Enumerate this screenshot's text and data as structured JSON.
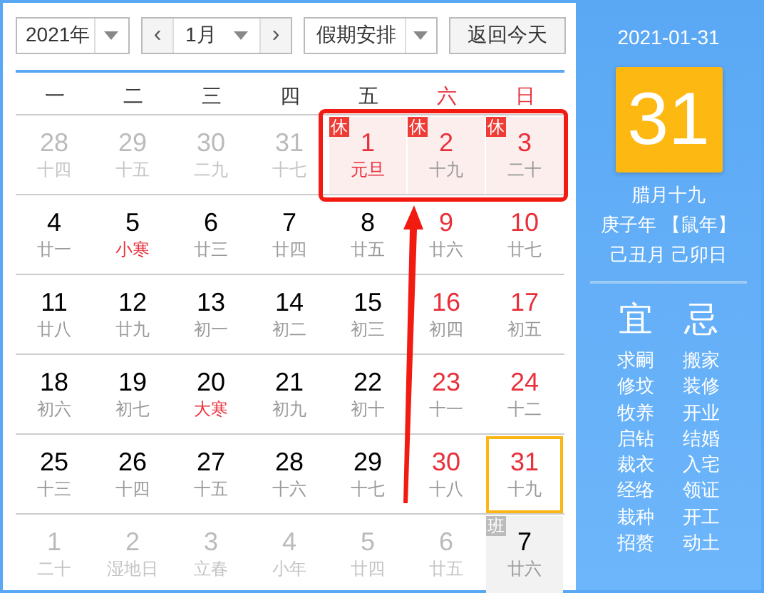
{
  "toolbar": {
    "year": "2021年",
    "prev": "‹",
    "month": "1月",
    "next": "›",
    "holiday_select": "假期安排",
    "today_button": "返回今天"
  },
  "weekdays": [
    {
      "label": "一",
      "weekend": false
    },
    {
      "label": "二",
      "weekend": false
    },
    {
      "label": "三",
      "weekend": false
    },
    {
      "label": "四",
      "weekend": false
    },
    {
      "label": "五",
      "weekend": false
    },
    {
      "label": "六",
      "weekend": true
    },
    {
      "label": "日",
      "weekend": true
    }
  ],
  "rows": [
    {
      "days": [
        {
          "day": "28",
          "lunar": "十四",
          "faded": true,
          "selected": false
        },
        {
          "day": "29",
          "lunar": "十五",
          "faded": true,
          "selected": false
        },
        {
          "day": "30",
          "lunar": "二九",
          "faded": true,
          "selected": false
        },
        {
          "day": "31",
          "lunar": "十七",
          "faded": true,
          "selected": false
        },
        {
          "day": "1",
          "lunar": "元旦",
          "faded": false,
          "festival": true,
          "selected": false,
          "tag": "休",
          "kind": "rest"
        },
        {
          "day": "2",
          "lunar": "十九",
          "faded": false,
          "festival": false,
          "selected": false,
          "tag": "休",
          "kind": "rest"
        },
        {
          "day": "3",
          "lunar": "二十",
          "faded": false,
          "festival": false,
          "selected": false,
          "tag": "休",
          "kind": "rest"
        }
      ]
    },
    {
      "days": [
        {
          "day": "4",
          "lunar": "廿一",
          "faded": false,
          "weekend": false,
          "festival": false,
          "selected": false
        },
        {
          "day": "5",
          "lunar": "小寒",
          "faded": false,
          "weekend": false,
          "festival": true,
          "selected": false
        },
        {
          "day": "6",
          "lunar": "廿三",
          "faded": false,
          "weekend": false,
          "festival": false,
          "selected": false
        },
        {
          "day": "7",
          "lunar": "廿四",
          "faded": false,
          "weekend": false,
          "festival": false,
          "selected": false
        },
        {
          "day": "8",
          "lunar": "廿五",
          "faded": false,
          "weekend": false,
          "festival": false,
          "selected": false
        },
        {
          "day": "9",
          "lunar": "廿六",
          "faded": false,
          "weekend": true,
          "festival": false,
          "selected": false
        },
        {
          "day": "10",
          "lunar": "廿七",
          "faded": false,
          "weekend": true,
          "festival": false,
          "selected": false
        }
      ]
    },
    {
      "days": [
        {
          "day": "11",
          "lunar": "廿八",
          "faded": false,
          "weekend": false,
          "festival": false,
          "selected": false
        },
        {
          "day": "12",
          "lunar": "廿九",
          "faded": false,
          "weekend": false,
          "festival": false,
          "selected": false
        },
        {
          "day": "13",
          "lunar": "初一",
          "faded": false,
          "weekend": false,
          "festival": false,
          "selected": false
        },
        {
          "day": "14",
          "lunar": "初二",
          "faded": false,
          "weekend": false,
          "festival": false,
          "selected": false
        },
        {
          "day": "15",
          "lunar": "初三",
          "faded": false,
          "weekend": false,
          "festival": false,
          "selected": false
        },
        {
          "day": "16",
          "lunar": "初四",
          "faded": false,
          "weekend": true,
          "festival": false,
          "selected": false
        },
        {
          "day": "17",
          "lunar": "初五",
          "faded": false,
          "weekend": true,
          "festival": false,
          "selected": false
        }
      ]
    },
    {
      "days": [
        {
          "day": "18",
          "lunar": "初六",
          "faded": false,
          "weekend": false,
          "festival": false,
          "selected": false
        },
        {
          "day": "19",
          "lunar": "初七",
          "faded": false,
          "weekend": false,
          "festival": false,
          "selected": false
        },
        {
          "day": "20",
          "lunar": "大寒",
          "faded": false,
          "weekend": false,
          "festival": true,
          "selected": false
        },
        {
          "day": "21",
          "lunar": "初九",
          "faded": false,
          "weekend": false,
          "festival": false,
          "selected": false
        },
        {
          "day": "22",
          "lunar": "初十",
          "faded": false,
          "weekend": false,
          "festival": false,
          "selected": false
        },
        {
          "day": "23",
          "lunar": "十一",
          "faded": false,
          "weekend": true,
          "festival": false,
          "selected": false
        },
        {
          "day": "24",
          "lunar": "十二",
          "faded": false,
          "weekend": true,
          "festival": false,
          "selected": false
        }
      ]
    },
    {
      "days": [
        {
          "day": "25",
          "lunar": "十三",
          "faded": false,
          "weekend": false,
          "festival": false,
          "selected": false
        },
        {
          "day": "26",
          "lunar": "十四",
          "faded": false,
          "weekend": false,
          "festival": false,
          "selected": false
        },
        {
          "day": "27",
          "lunar": "十五",
          "faded": false,
          "weekend": false,
          "festival": false,
          "selected": false
        },
        {
          "day": "28",
          "lunar": "十六",
          "faded": false,
          "weekend": false,
          "festival": false,
          "selected": false
        },
        {
          "day": "29",
          "lunar": "十七",
          "faded": false,
          "weekend": false,
          "festival": false,
          "selected": false
        },
        {
          "day": "30",
          "lunar": "十八",
          "faded": false,
          "weekend": true,
          "festival": false,
          "selected": false
        },
        {
          "day": "31",
          "lunar": "十九",
          "faded": false,
          "weekend": true,
          "festival": false,
          "selected": true
        }
      ]
    },
    {
      "days": [
        {
          "day": "1",
          "lunar": "二十",
          "faded": true,
          "selected": false
        },
        {
          "day": "2",
          "lunar": "湿地日",
          "faded": true,
          "selected": false
        },
        {
          "day": "3",
          "lunar": "立春",
          "faded": true,
          "selected": false
        },
        {
          "day": "4",
          "lunar": "小年",
          "faded": true,
          "selected": false
        },
        {
          "day": "5",
          "lunar": "廿四",
          "faded": true,
          "selected": false
        },
        {
          "day": "6",
          "lunar": "廿五",
          "faded": true,
          "selected": false
        },
        {
          "day": "7",
          "lunar": "廿六",
          "faded": false,
          "weekend": false,
          "festival": false,
          "selected": false,
          "tag": "班",
          "kind": "work"
        }
      ]
    }
  ],
  "side": {
    "date": "2021-01-31",
    "big_day": "31",
    "lunar_lines": [
      "腊月十九",
      "庚子年 【鼠年】",
      "己丑月 己卯日"
    ],
    "good": {
      "title": "宜",
      "items": [
        "求嗣",
        "修坟",
        "牧养",
        "启钻",
        "裁衣",
        "经络",
        "栽种",
        "招赘"
      ]
    },
    "bad": {
      "title": "忌",
      "items": [
        "搬家",
        "装修",
        "开业",
        "结婚",
        "入宅",
        "领证",
        "开工",
        "动土"
      ]
    }
  }
}
